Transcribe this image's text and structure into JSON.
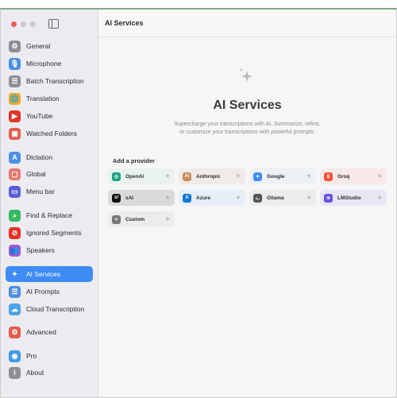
{
  "window": {
    "title": "AI Services"
  },
  "sidebar": {
    "items": [
      {
        "name": "general",
        "label": "General",
        "icon": "gear-icon",
        "glyph": "⚙",
        "color": "#8e8e93"
      },
      {
        "name": "microphone",
        "label": "Microphone",
        "icon": "microphone-icon",
        "glyph": "🎙",
        "color": "#4a90e2"
      },
      {
        "name": "batch-transcription",
        "label": "Batch Transcription",
        "icon": "list-icon",
        "glyph": "☰",
        "color": "#8e8e93"
      },
      {
        "name": "translation",
        "label": "Translation",
        "icon": "globe-icon",
        "glyph": "🌐",
        "color": "#f5a623"
      },
      {
        "name": "youtube",
        "label": "YouTube",
        "icon": "youtube-icon",
        "glyph": "▶",
        "color": "#e0342b"
      },
      {
        "name": "watched-folders",
        "label": "Watched Folders",
        "icon": "folder-icon",
        "glyph": "▣",
        "color": "#e35d4f"
      },
      {
        "name": "dictation",
        "label": "Dictation",
        "icon": "text-cursor-icon",
        "glyph": "A",
        "color": "#4a90e2"
      },
      {
        "name": "global",
        "label": "Global",
        "icon": "window-icon",
        "glyph": "▢",
        "color": "#e8776b"
      },
      {
        "name": "menu-bar",
        "label": "Menu bar",
        "icon": "menu-bar-icon",
        "glyph": "▭",
        "color": "#5a5fd6"
      },
      {
        "name": "find-replace",
        "label": "Find & Replace",
        "icon": "magnifier-icon",
        "glyph": "⌕",
        "color": "#34b960"
      },
      {
        "name": "ignored-segments",
        "label": "Ignored Segments",
        "icon": "block-list-icon",
        "glyph": "⊘",
        "color": "#e0342b"
      },
      {
        "name": "speakers",
        "label": "Speakers",
        "icon": "people-icon",
        "glyph": "👥",
        "color": "#9b59d0"
      },
      {
        "name": "ai-services",
        "label": "AI Services",
        "icon": "sparkles-icon",
        "glyph": "✦",
        "color": "#3e8bf4"
      },
      {
        "name": "ai-prompts",
        "label": "AI Prompts",
        "icon": "list-icon",
        "glyph": "☰",
        "color": "#4a90e2"
      },
      {
        "name": "cloud-transcription",
        "label": "Cloud Transcription",
        "icon": "cloud-icon",
        "glyph": "☁",
        "color": "#4aa3e8"
      },
      {
        "name": "advanced",
        "label": "Advanced",
        "icon": "gears-icon",
        "glyph": "⚙",
        "color": "#e35d4f"
      },
      {
        "name": "pro",
        "label": "Pro",
        "icon": "pro-badge-icon",
        "glyph": "◉",
        "color": "#3e9be8"
      },
      {
        "name": "about",
        "label": "About",
        "icon": "info-icon",
        "glyph": "i",
        "color": "#8e8e93"
      }
    ],
    "selected": "ai-services"
  },
  "main": {
    "heading": "AI Services",
    "subtitle_line1": "Supercharge your transcriptions with AI. Summarize, refine,",
    "subtitle_line2": "or customize your transcriptions with powerful prompts.",
    "section_label": "Add a provider",
    "providers": [
      {
        "name": "openai",
        "label": "OpenAI",
        "icon": "openai-icon",
        "glyph": "◎",
        "color": "#19a37f",
        "bg": "#e9f2ee"
      },
      {
        "name": "anthropic",
        "label": "Anthropic",
        "icon": "anthropic-icon",
        "glyph": "A\\",
        "color": "#c98a5a",
        "bg": "#efebe8"
      },
      {
        "name": "google",
        "label": "Google",
        "icon": "google-gemini-icon",
        "glyph": "✦",
        "color": "#3e8bf4",
        "bg": "#edf0f5"
      },
      {
        "name": "groq",
        "label": "Groq",
        "icon": "groq-icon",
        "glyph": "g",
        "color": "#f55036",
        "bg": "#f6e9e7"
      },
      {
        "name": "xai",
        "label": "xAI",
        "icon": "xai-icon",
        "glyph": "x/",
        "color": "#111111",
        "bg": "#dadadc"
      },
      {
        "name": "azure",
        "label": "Azure",
        "icon": "azure-icon",
        "glyph": "A",
        "color": "#0f78d4",
        "bg": "#e6eef6"
      },
      {
        "name": "ollama",
        "label": "Ollama",
        "icon": "ollama-icon",
        "glyph": "ᓚ",
        "color": "#555555",
        "bg": "#ececee"
      },
      {
        "name": "lmstudio",
        "label": "LMStudio",
        "icon": "lmstudio-icon",
        "glyph": "≋",
        "color": "#6a4fe0",
        "bg": "#e9e6f3"
      },
      {
        "name": "custom",
        "label": "Custom",
        "icon": "sparkles-icon",
        "glyph": "✧",
        "color": "#777777",
        "bg": "#ececee"
      }
    ]
  }
}
